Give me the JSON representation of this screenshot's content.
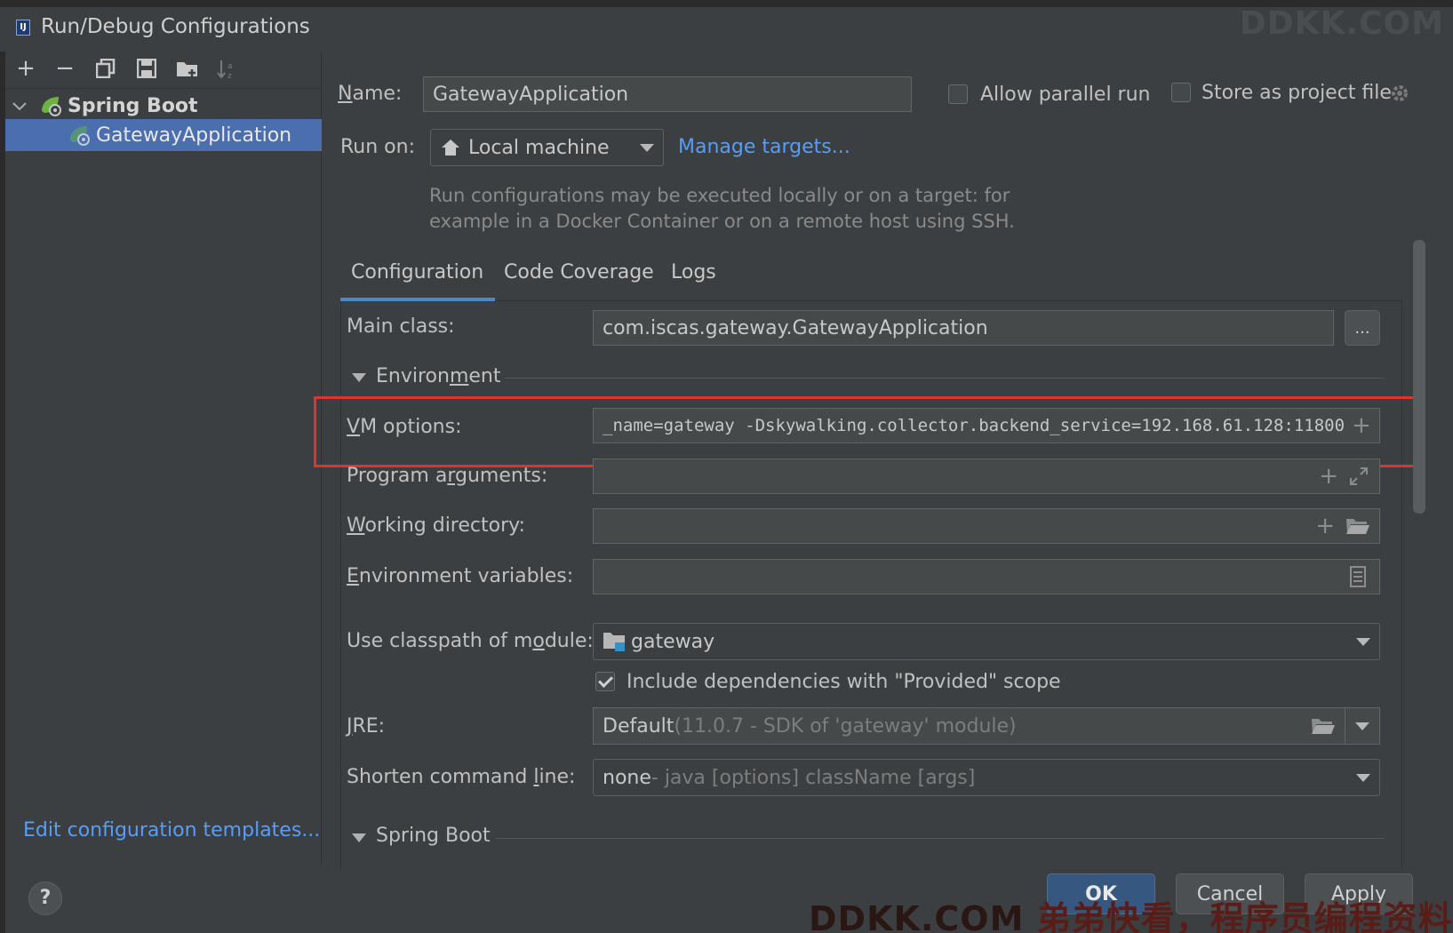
{
  "window": {
    "title": "Run/Debug Configurations",
    "watermark_top": "DDKK.COM",
    "watermark_bottom_a": "DDKK.COM ",
    "watermark_bottom_b": "弟弟快看，程序员编程资料站"
  },
  "left": {
    "toolbar": {
      "add_label": "+",
      "remove_label": "−"
    },
    "tree": {
      "group_label": "Spring Boot",
      "item_label": "GatewayApplication"
    },
    "edit_templates": "Edit configuration templates..."
  },
  "header": {
    "name_label": "Name:",
    "name_value": "GatewayApplication",
    "allow_parallel": "Allow parallel run",
    "store_project": "Store as project file",
    "run_on_label": "Run on:",
    "run_on_value": "Local machine",
    "manage_targets": "Manage targets...",
    "hint_line1": "Run configurations may be executed locally or on a target: for",
    "hint_line2": "example in a Docker Container or on a remote host using SSH."
  },
  "tabs": [
    {
      "label": "Configuration"
    },
    {
      "label": "Code Coverage"
    },
    {
      "label": "Logs"
    }
  ],
  "config": {
    "main_class_label": "Main class:",
    "main_class_value": "com.iscas.gateway.GatewayApplication",
    "browse_label": "...",
    "environment_section": "Environment",
    "vm_options_label": "VM options:",
    "vm_options_value": "_name=gateway -Dskywalking.collector.backend_service=192.168.61.128:11800",
    "program_args_label": "Program arguments:",
    "working_dir_label": "Working directory:",
    "env_vars_label": "Environment variables:",
    "classpath_label": "Use classpath of module:",
    "classpath_value": "gateway",
    "include_deps": "Include dependencies with \"Provided\" scope",
    "jre_label": "JRE:",
    "jre_value": "Default",
    "jre_detail": " (11.0.7 - SDK of 'gateway' module)",
    "shorten_label": "Shorten command line:",
    "shorten_value": "none",
    "shorten_detail": " - java [options] className [args]",
    "springboot_section": "Spring Boot"
  },
  "buttons": {
    "ok": "OK",
    "cancel": "Cancel",
    "apply": "Apply",
    "help": "?"
  }
}
